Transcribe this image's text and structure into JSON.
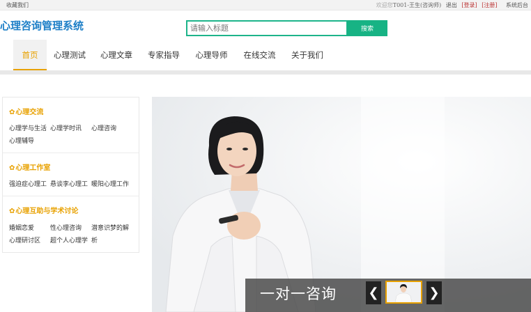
{
  "topbar": {
    "favorite": "收藏我们",
    "welcome": "欢迎您",
    "user": "T001-王生(咨询师)",
    "logout": "退出",
    "login": "[登录]",
    "register": "[注册]",
    "admin": "系统后台"
  },
  "header": {
    "logo": "心理咨询管理系统",
    "search_placeholder": "请输入标题",
    "search_button": "搜索"
  },
  "nav": {
    "items": [
      {
        "label": "首页",
        "active": true
      },
      {
        "label": "心理测试"
      },
      {
        "label": "心理文章"
      },
      {
        "label": "专家指导"
      },
      {
        "label": "心理导师"
      },
      {
        "label": "在线交流"
      },
      {
        "label": "关于我们"
      }
    ]
  },
  "sidebar": {
    "sections": [
      {
        "title": "心理交流",
        "links": [
          "心理学与生活",
          "心理学时讯",
          "心理咨询",
          "心理辅导"
        ]
      },
      {
        "title": "心理工作室",
        "links": [
          "强迫症心理工",
          "悬谈李心理工",
          "暖阳心理工作"
        ]
      },
      {
        "title": "心理互助与学术讨论",
        "links": [
          "婚姻恋爱",
          "性心理咨询",
          "潜意识梦的解",
          "心理研讨区",
          "超个人心理学",
          "析"
        ]
      }
    ],
    "gear_icon": "gear-icon"
  },
  "banner": {
    "caption": "一对一咨询",
    "prev_icon": "chevron-left-icon",
    "next_icon": "chevron-right-icon"
  },
  "colors": {
    "brand": "#1e7fc7",
    "accent": "#e8a100",
    "search_green": "#17b384"
  }
}
